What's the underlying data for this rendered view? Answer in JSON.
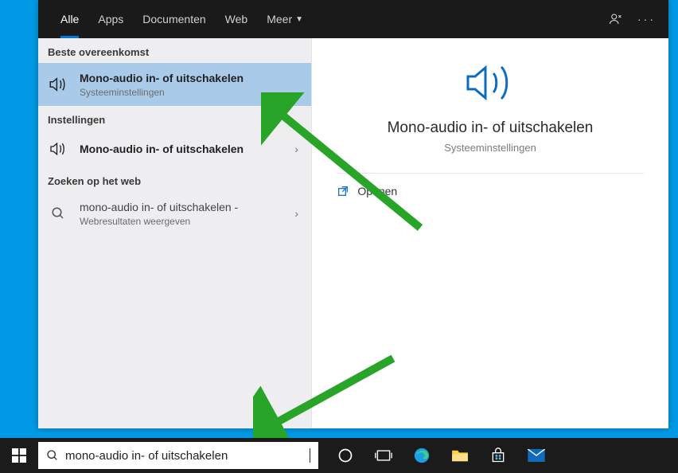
{
  "tabs": {
    "all": "Alle",
    "apps": "Apps",
    "docs": "Documenten",
    "web": "Web",
    "more": "Meer"
  },
  "left": {
    "best_match_header": "Beste overeenkomst",
    "best_match_title": "Mono-audio in- of uitschakelen",
    "best_match_sub": "Systeeminstellingen",
    "settings_header": "Instellingen",
    "settings_item": "Mono-audio in- of uitschakelen",
    "web_header": "Zoeken op het web",
    "web_item_title": "mono-audio in- of uitschakelen -",
    "web_item_sub": "Webresultaten weergeven"
  },
  "detail": {
    "title": "Mono-audio in- of uitschakelen",
    "sub": "Systeeminstellingen",
    "open": "Openen"
  },
  "search": {
    "value": "mono-audio in- of uitschakelen"
  },
  "colors": {
    "accent": "#0078d4",
    "green": "#28a428"
  }
}
